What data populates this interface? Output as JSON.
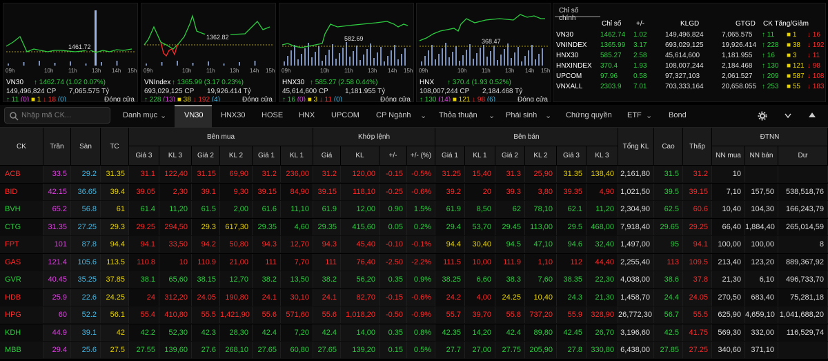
{
  "colors": {
    "up": "#2ecc40",
    "down": "#ff2a2a",
    "ref": "#e8d200",
    "ceil": "#e23ce6",
    "floor": "#3fb8e8",
    "white": "#ffffff",
    "matched": "#22d3e6"
  },
  "mini_charts": [
    {
      "name": "VN30",
      "arrow": "↑",
      "value": "1462.74",
      "change": "(1.02 0.07%)",
      "volume": "149,496,824 CP",
      "total": "7,065.575 Tỷ",
      "up": "↑ 11",
      "up_count": "(0)",
      "ref": "■ 1",
      "down": "↓ 18",
      "down_count": "(0)",
      "status": "Đóng cửa",
      "close": "1461.72",
      "ticks": [
        "09h",
        "10h",
        "11h",
        "13h",
        "14h",
        "15h"
      ]
    },
    {
      "name": "VNIndex",
      "arrow": "↑",
      "value": "1365.99",
      "change": "(3.17 0.23%)",
      "volume": "693,029,125 CP",
      "total": "19,926.414 Tỷ",
      "up": "↑ 228",
      "up_count": "(13)",
      "ref": "■ 38",
      "down": "↓ 192",
      "down_count": "(4)",
      "status": "Đóng cửa",
      "close": "1362.82",
      "ticks": [
        "09h",
        "10h",
        "11h",
        "13h",
        "14h",
        "15h"
      ]
    },
    {
      "name": "HNX30",
      "arrow": "↑",
      "value": "585.27",
      "change": "(2.58 0.44%)",
      "volume": "45,614,600 CP",
      "total": "1,181.955 Tỷ",
      "up": "↑ 16",
      "up_count": "(0)",
      "ref": "■ 3",
      "down": "↓ 11",
      "down_count": "(0)",
      "status": "Đóng cửa",
      "close": "582.69",
      "ticks": [
        "09h",
        "10h",
        "11h",
        "13h",
        "14h",
        "15h"
      ]
    },
    {
      "name": "HNX",
      "arrow": "↑",
      "value": "370.4",
      "change": "(1.93 0.52%)",
      "volume": "108,007,244 CP",
      "total": "2,184.468 Tỷ",
      "up": "↑ 130",
      "up_count": "(14)",
      "ref": "■ 121",
      "down": "↓ 98",
      "down_count": "(6)",
      "status": "Đóng cửa",
      "close": "368.47",
      "ticks": [
        "09h",
        "10h",
        "11h",
        "13h",
        "14h",
        "15h"
      ]
    }
  ],
  "index_panel": {
    "tab": "Chỉ số chính",
    "headers": [
      "Chỉ số",
      "+/-",
      "KLGD",
      "GTGD",
      "CK Tăng/Giảm"
    ],
    "rows": [
      {
        "name": "VN30",
        "value": "1462.74",
        "change": "1.02",
        "klgd": "149,496,824",
        "gtgd": "7,065.575",
        "up": "↑ 11",
        "ref": "■ 1",
        "down": "↓ 16"
      },
      {
        "name": "VNINDEX",
        "value": "1365.99",
        "change": "3.17",
        "klgd": "693,029,125",
        "gtgd": "19,926.414",
        "up": "↑ 228",
        "ref": "■ 38",
        "down": "↓ 192"
      },
      {
        "name": "HNX30",
        "value": "585.27",
        "change": "2.58",
        "klgd": "45,614,600",
        "gtgd": "1,181.955",
        "up": "↑ 16",
        "ref": "■ 3",
        "down": "↓ 11"
      },
      {
        "name": "HNXINDEX",
        "value": "370.4",
        "change": "1.93",
        "klgd": "108,007,244",
        "gtgd": "2,184.468",
        "up": "↑ 130",
        "ref": "■ 121",
        "down": "↓ 98"
      },
      {
        "name": "UPCOM",
        "value": "97.96",
        "change": "0.58",
        "klgd": "97,327,103",
        "gtgd": "2,061.527",
        "up": "↑ 209",
        "ref": "■ 587",
        "down": "↓ 108"
      },
      {
        "name": "VNXALL",
        "value": "2303.9",
        "change": "7.01",
        "klgd": "703,333,164",
        "gtgd": "20,658.055",
        "up": "↑ 253",
        "ref": "■ 55",
        "down": "↓ 183"
      }
    ]
  },
  "toolbar": {
    "search_placeholder": "Nhập mã CK...",
    "tabs": [
      "Danh mục",
      "VN30",
      "HNX30",
      "HOSE",
      "HNX",
      "UPCOM",
      "CP Ngành",
      "Thỏa thuận",
      "Phái sinh",
      "Chứng quyền",
      "ETF",
      "Bond"
    ]
  },
  "table": {
    "groups": {
      "ck": "CK",
      "tran": "Trần",
      "san": "Sàn",
      "tc": "TC",
      "buy": "Bên mua",
      "match": "Khớp lệnh",
      "sell": "Bên bán",
      "total": "Tổng KL",
      "high": "Cao",
      "low": "Thấp",
      "foreign": "ĐTNN"
    },
    "sub": {
      "buy": [
        "Giá 3",
        "KL 3",
        "Giá 2",
        "KL 2",
        "Giá 1",
        "KL 1"
      ],
      "match": [
        "Giá",
        "KL",
        "+/-",
        "+/- (%)"
      ],
      "sell": [
        "Giá 1",
        "KL 1",
        "Giá 2",
        "KL 2",
        "Giá 3",
        "KL 3"
      ],
      "foreign": [
        "NN mua",
        "NN bán",
        "Dư"
      ]
    },
    "rows": [
      {
        "v": [
          "ACB",
          "33.5",
          "29.2",
          "31.35",
          "31.1",
          "122,40",
          "31.15",
          "69,90",
          "31.2",
          "236,00",
          "31.2",
          "120,00",
          "-0.15",
          "-0.5%",
          "31.25",
          "15,40",
          "31.3",
          "25,90",
          "31.35",
          "138,40",
          "2,161,80",
          "31.5",
          "31.2",
          "10",
          "",
          ""
        ],
        "c": "dddddddddddrrruuuuyyndurrwnn"
      },
      {
        "v": [
          "BID",
          "42.15",
          "36.65",
          "39.4",
          "39.05",
          "2,30",
          "39.1",
          "9,30",
          "39.15",
          "84,90",
          "39.15",
          "118,10",
          "-0.25",
          "-0.6%",
          "39.2",
          "20",
          "39.3",
          "3,80",
          "39.35",
          "4,90",
          "1,021,50",
          "39.5",
          "39.15",
          "7,10",
          "157,50",
          "538,518,76"
        ],
        "c": ""
      },
      {
        "v": [
          "BVH",
          "65.2",
          "56.8",
          "61",
          "61.4",
          "11,20",
          "61.5",
          "2,00",
          "61.6",
          "11,10",
          "61.9",
          "12,00",
          "0.90",
          "1.5%",
          "61.9",
          "8,50",
          "62",
          "78,10",
          "62.1",
          "11,20",
          "2,304,90",
          "62.5",
          "60.6",
          "10,40",
          "104,30",
          "166,243,79"
        ],
        "c": ""
      },
      {
        "v": [
          "CTG",
          "31.35",
          "27.25",
          "29.3",
          "29.25",
          "294,50",
          "29.3",
          "617,30",
          "29.35",
          "4,60",
          "29.35",
          "415,60",
          "0.05",
          "0.2%",
          "29.4",
          "53,70",
          "29.45",
          "113,00",
          "29.5",
          "468,00",
          "7,918,40",
          "29.65",
          "29.25",
          "66,40",
          "1,884,40",
          "265,014,59"
        ],
        "c": ""
      },
      {
        "v": [
          "FPT",
          "101",
          "87.8",
          "94.4",
          "94.1",
          "33,50",
          "94.2",
          "50,80",
          "94.3",
          "12,70",
          "94.3",
          "45,40",
          "-0.10",
          "-0.1%",
          "94.4",
          "30,40",
          "94.5",
          "47,10",
          "94.6",
          "32,40",
          "1,497,00",
          "95",
          "94.1",
          "100,00",
          "100,00",
          "8"
        ],
        "c": ""
      },
      {
        "v": [
          "GAS",
          "121.4",
          "105.6",
          "113.5",
          "110.8",
          "10",
          "110.9",
          "21,00",
          "111",
          "7,70",
          "111",
          "76,40",
          "-2.50",
          "-2.2%",
          "111.5",
          "10,00",
          "111.9",
          "1,10",
          "112",
          "44,40",
          "2,255,40",
          "113",
          "109.5",
          "213,40",
          "123,20",
          "889,367,92"
        ],
        "c": ""
      },
      {
        "v": [
          "GVR",
          "40.45",
          "35.25",
          "37.85",
          "38.1",
          "65,60",
          "38.15",
          "12,70",
          "38.2",
          "13,50",
          "38.2",
          "56,20",
          "0.35",
          "0.9%",
          "38.25",
          "6,60",
          "38.3",
          "7,60",
          "38.35",
          "22,30",
          "4,038,00",
          "38.6",
          "37.8",
          "21,30",
          "6,10",
          "496,733,70"
        ],
        "c": ""
      },
      {
        "v": [
          "HDB",
          "25.9",
          "22.6",
          "24.25",
          "24",
          "312,20",
          "24.05",
          "190,80",
          "24.1",
          "30,10",
          "24.1",
          "82,70",
          "-0.15",
          "-0.6%",
          "24.2",
          "4,00",
          "24.25",
          "10,40",
          "24.3",
          "21,30",
          "1,458,70",
          "24.4",
          "24.05",
          "270,50",
          "683,40",
          "75,281,18"
        ],
        "c": ""
      },
      {
        "v": [
          "HPG",
          "60",
          "52.2",
          "56.1",
          "55.4",
          "410,80",
          "55.5",
          "1,421,90",
          "55.6",
          "571,60",
          "55.6",
          "1,018,20",
          "-0.50",
          "-0.9%",
          "55.7",
          "39,70",
          "55.8",
          "737,20",
          "55.9",
          "328,90",
          "26,772,30",
          "56.7",
          "55.5",
          "625,90",
          "4,659,10",
          "1,041,688,20"
        ],
        "c": ""
      },
      {
        "v": [
          "KDH",
          "44.9",
          "39.1",
          "42",
          "42.2",
          "52,30",
          "42.3",
          "28,30",
          "42.4",
          "7,20",
          "42.4",
          "14,00",
          "0.35",
          "0.8%",
          "42.35",
          "14,20",
          "42.4",
          "89,80",
          "42.45",
          "26,70",
          "3,196,60",
          "42.5",
          "41.75",
          "569,30",
          "332,00",
          "116,529,74"
        ],
        "c": ""
      },
      {
        "v": [
          "MBB",
          "29.4",
          "25.6",
          "27.5",
          "27.55",
          "139,60",
          "27.6",
          "268,10",
          "27.65",
          "60,80",
          "27.65",
          "139,20",
          "0.15",
          "0.5%",
          "27.7",
          "27,00",
          "27.75",
          "205,90",
          "27.8",
          "330,80",
          "6,438,00",
          "27.85",
          "27.25",
          "340,60",
          "371,10",
          ""
        ],
        "c": ""
      }
    ]
  }
}
